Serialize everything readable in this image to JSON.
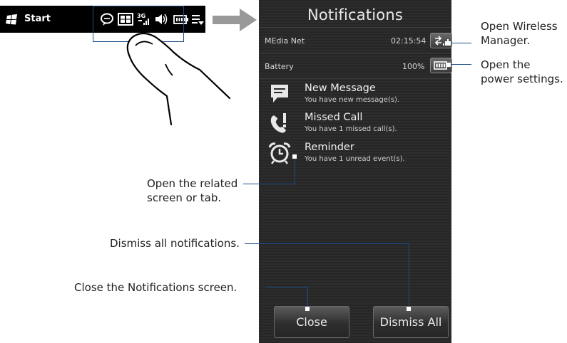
{
  "taskbar": {
    "start_label": "Start",
    "icons": [
      "message-icon",
      "3g-icon",
      "signal-icon",
      "volume-icon",
      "battery-icon",
      "menu-icon"
    ]
  },
  "phone": {
    "title": "Notifications",
    "status_rows": [
      {
        "name": "MEdia Net",
        "value": "02:15:54",
        "button_icon": "wireless-manager-icon"
      },
      {
        "name": "Battery",
        "value": "100%",
        "button_icon": "battery-icon"
      }
    ],
    "notifications": [
      {
        "title": "New Message",
        "subtitle": "You have new message(s).",
        "icon": "message-icon"
      },
      {
        "title": "Missed Call",
        "subtitle": "You have 1 missed call(s).",
        "icon": "missed-call-icon"
      },
      {
        "title": "Reminder",
        "subtitle": "You have 1 unread event(s).",
        "icon": "alarm-clock-icon"
      }
    ],
    "close_label": "Close",
    "dismiss_label": "Dismiss All"
  },
  "callouts": {
    "wireless_1": "Open Wireless",
    "wireless_2": "Manager.",
    "power_1": "Open the",
    "power_2": "power settings.",
    "related_1": "Open the related",
    "related_2": "screen or tab.",
    "dismiss": "Dismiss all notifications.",
    "close": "Close the Notifications screen."
  },
  "colors": {
    "callout_line": "#1f4e8a",
    "arrow": "#999999",
    "panel_bg": "#2a2a2a"
  }
}
